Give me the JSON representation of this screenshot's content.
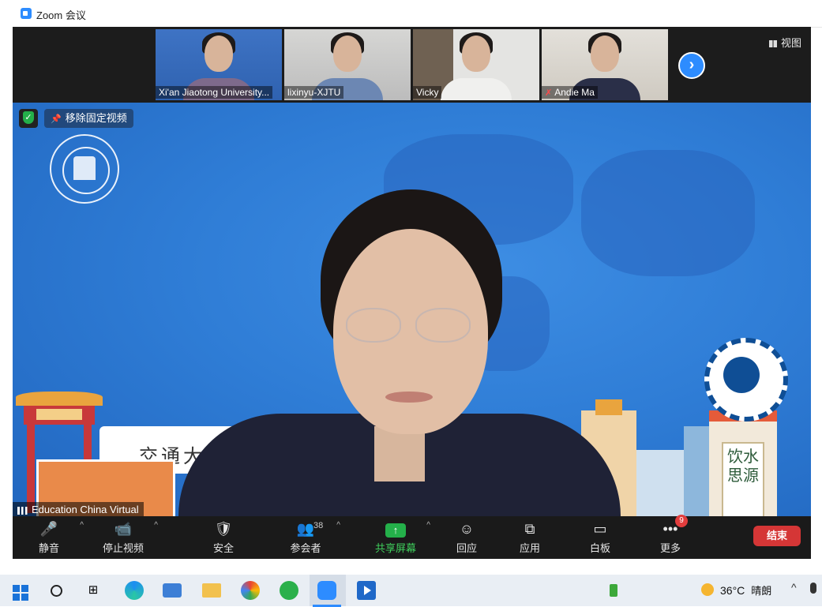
{
  "window": {
    "title": "Zoom 会议"
  },
  "gallery": {
    "participants": [
      {
        "name": "Xi'an Jiaotong University..."
      },
      {
        "name": "lixinyu-XJTU"
      },
      {
        "name": "Vicky"
      },
      {
        "name": "Andie Ma",
        "muted": true
      }
    ],
    "view_label": "视图",
    "next_icon": "chevron-right-icon"
  },
  "main_video": {
    "unpin_label": "移除固定视频",
    "speaker_name": "Education China Virtual",
    "banner_text": "交通大學",
    "plaque_text": "饮水思源"
  },
  "toolbar": {
    "mute_label": "静音",
    "stop_video_label": "停止视频",
    "security_label": "安全",
    "participants_label": "参会者",
    "participants_count": "38",
    "share_label": "共享屏幕",
    "reactions_label": "回应",
    "apps_label": "应用",
    "whiteboard_label": "白板",
    "more_label": "更多",
    "more_badge": "9",
    "end_label": "结束"
  },
  "taskbar": {
    "temperature": "36°C",
    "weather": "晴朗"
  },
  "colors": {
    "zoom_blue": "#2d8cff",
    "share_green": "#24b04a",
    "end_red": "#d53636",
    "meeting_bg": "#1a1a1a"
  }
}
